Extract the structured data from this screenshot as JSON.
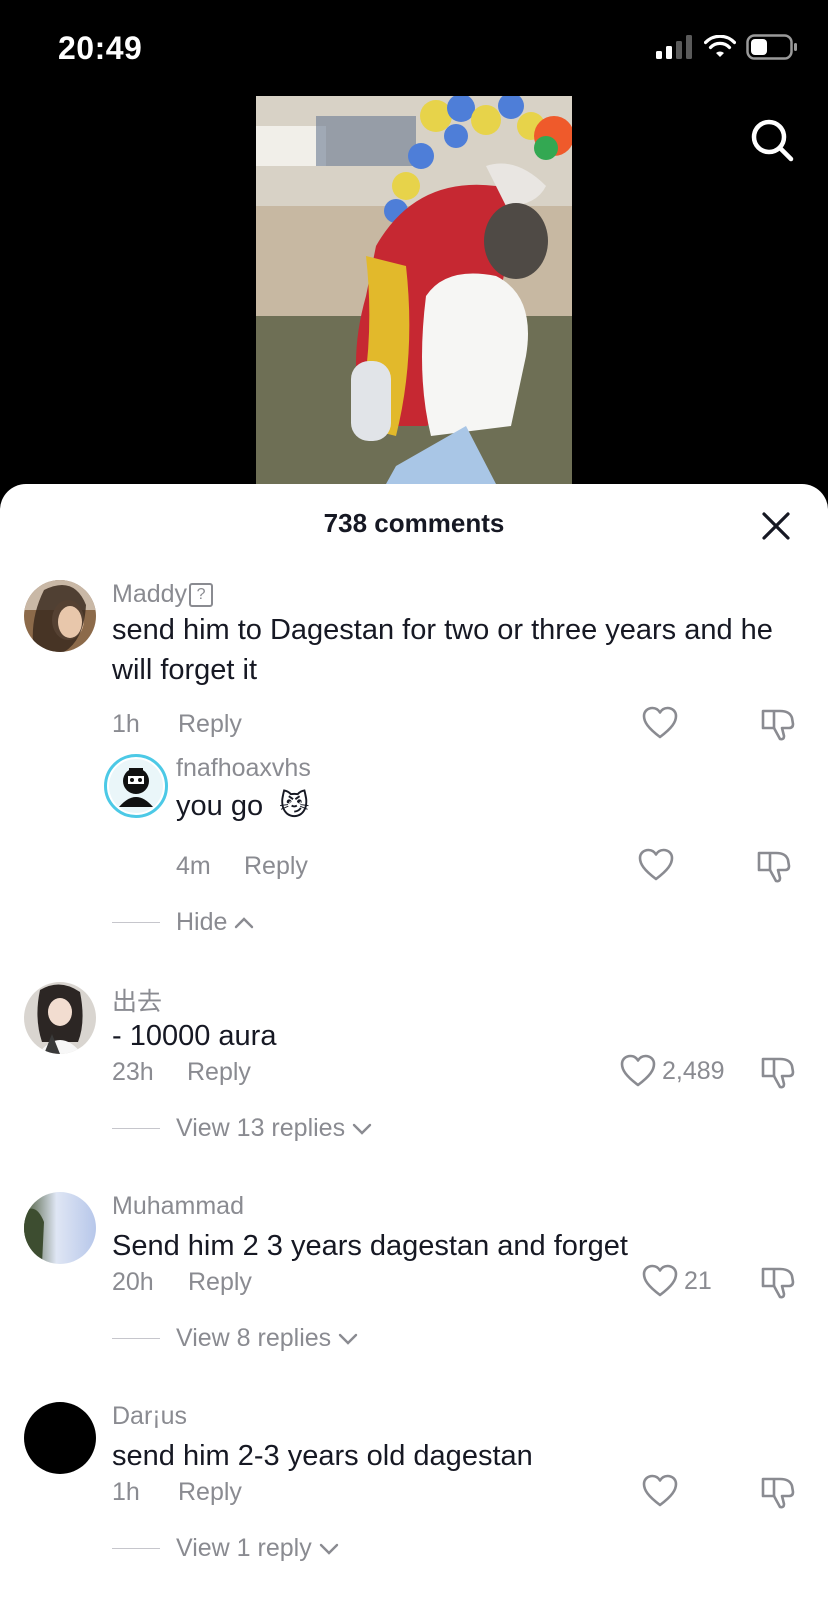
{
  "status": {
    "time": "20:49"
  },
  "sheet": {
    "title": "738 comments"
  },
  "comments": [
    {
      "username": "Maddy",
      "badge": "?",
      "text": "send him to Dagestan for two or three years and he will forget it",
      "time": "1h",
      "reply_label": "Reply",
      "likes": "",
      "replies": [
        {
          "username": "fnafhoaxvhs",
          "text": "you go",
          "emoji": "😼",
          "time": "4m",
          "reply_label": "Reply",
          "likes": ""
        }
      ],
      "thread_label": "Hide"
    },
    {
      "username": "出去",
      "text": "- 10000 aura",
      "time": "23h",
      "reply_label": "Reply",
      "likes": "2,489",
      "thread_label": "View 13 replies"
    },
    {
      "username": "Muhammad",
      "text": "Send him 2 3 years dagestan and forget",
      "time": "20h",
      "reply_label": "Reply",
      "likes": "21",
      "thread_label": "View 8 replies"
    },
    {
      "username": "Dar¡us",
      "text": "send him 2-3 years old dagestan",
      "time": "1h",
      "reply_label": "Reply",
      "likes": "",
      "thread_label": "View 1 reply"
    }
  ],
  "icons": {
    "search": "search-icon",
    "close": "close-icon",
    "like": "heart-icon",
    "dislike": "thumbs-down-icon"
  }
}
